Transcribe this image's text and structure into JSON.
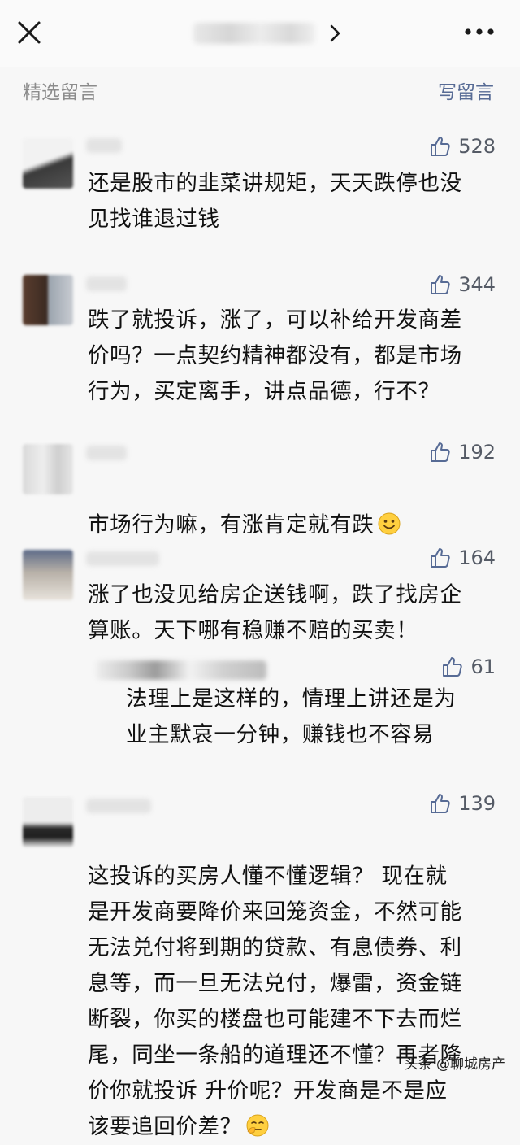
{
  "header": {
    "section_title": "精选留言",
    "write_label": "写留言"
  },
  "comments": [
    {
      "likes": "528",
      "text": "还是股市的韭菜讲规矩，天天跌停也没\n见找谁退过钱"
    },
    {
      "likes": "344",
      "text": "跌了就投诉，涨了，可以补给开发商差\n价吗？一点契约精神都没有，都是市场\n行为，买定离手，讲点品德，行不？"
    },
    {
      "likes": "192",
      "text": "市场行为嘛，有涨肯定就有跌"
    },
    {
      "likes": "164",
      "text": "涨了也没见给房企送钱啊，跌了找房企\n算账。天下哪有稳赚不赔的买卖！"
    },
    {
      "likes": "61",
      "text": "法理上是这样的，情理上讲还是为\n业主默哀一分钟，赚钱也不容易"
    },
    {
      "likes": "139",
      "text": "这投诉的买房人懂不懂逻辑？ 现在就\n是开发商要降价来回笼资金，不然可能\n无法兑付将到期的贷款、有息债券、利\n息等，而一旦无法兑付，爆雷，资金链\n断裂，你买的楼盘也可能建不下去而烂\n尾，同坐一条船的道理还不懂？再者降\n价你就投诉 升价呢？开发商是不是应\n该要追回价差？"
    }
  ],
  "watermark": "头条 @聊城房产",
  "icons": [
    "close-icon",
    "chevron-right-icon",
    "more-dots-icon",
    "thumbs-up-icon",
    "smile-emoji-icon",
    "facepalm-emoji-icon"
  ],
  "colors": {
    "link": "#576b95",
    "muted": "#8c8c8c",
    "background": "#f7f7f7"
  }
}
